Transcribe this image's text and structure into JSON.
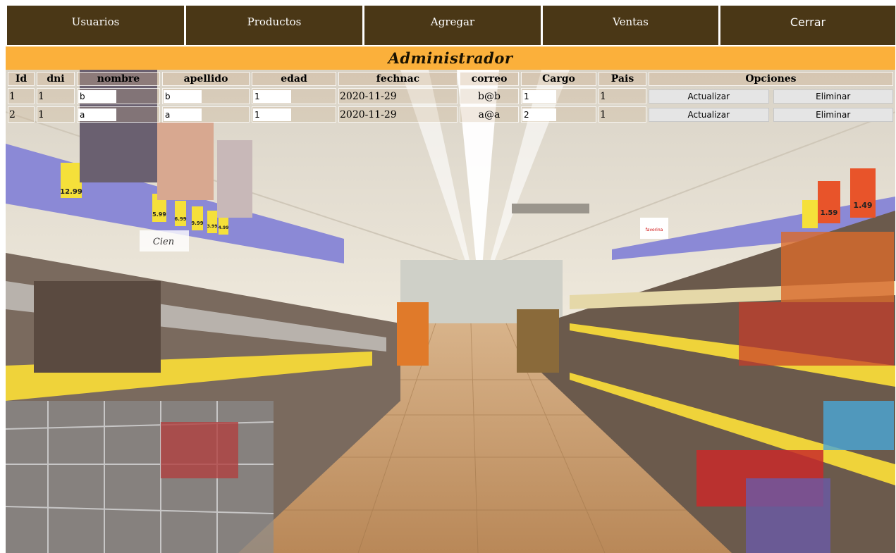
{
  "nav": {
    "items": [
      "Usuarios",
      "Productos",
      "Agregar",
      "Ventas",
      "Cerrar"
    ]
  },
  "title": "Administrador",
  "table": {
    "headers": [
      "Id",
      "dni",
      "nombre",
      "apellido",
      "edad",
      "fechnac",
      "correo",
      "Cargo",
      "Pais",
      "Opciones"
    ],
    "rows": [
      {
        "id": "1",
        "dni": "1",
        "nombre": "b",
        "apellido": "b",
        "edad": "1",
        "fechnac": "2020-11-29",
        "correo": "b@b",
        "cargo": "1",
        "pais": "1"
      },
      {
        "id": "2",
        "dni": "1",
        "nombre": "a",
        "apellido": "a",
        "edad": "1",
        "fechnac": "2020-11-29",
        "correo": "a@a",
        "cargo": "2",
        "pais": "1"
      }
    ],
    "update_label": "Actualizar",
    "delete_label": "Eliminar"
  },
  "background": {
    "scene": "supermarket-aisle",
    "colors": {
      "nav": "#4a3716",
      "title_bar": "#fbb03b"
    },
    "price_tags": [
      "12.99",
      "5.99",
      "6.99",
      "9.99",
      "3.99",
      "4.99",
      "1.59",
      "1.49"
    ],
    "ceiling_banner": "Cien",
    "store_sign": "favorina"
  }
}
